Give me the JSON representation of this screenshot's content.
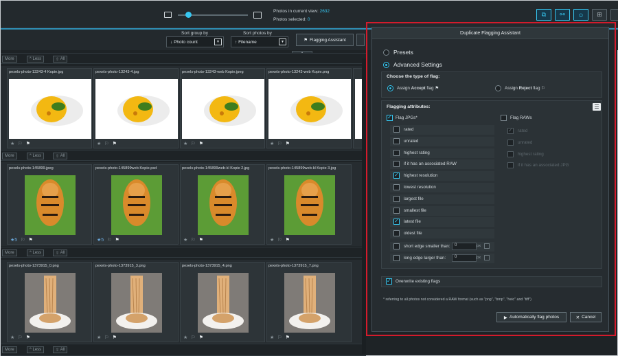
{
  "toolbar": {
    "photos_in_view_label": "Photos in current view:",
    "photos_in_view_value": "2632",
    "photos_selected_label": "Photos selected:",
    "photos_selected_value": "0",
    "zoom_level": 0.15
  },
  "sort": {
    "group_label": "Sort group by",
    "group_value": "Photo count",
    "photos_label": "Sort photos by",
    "photos_value": "Filename",
    "flagging_assistant_label": "Flagging Assistant"
  },
  "group_controls": {
    "more": "More",
    "less": "Less",
    "all": "All"
  },
  "groups": [
    {
      "photos": [
        {
          "filename": "pexels-photo-13243-4 Kopie.jpg"
        },
        {
          "filename": "pexels-photo-13243-4.jpg"
        },
        {
          "filename": "pexels-photo-13243-web Kopie.jpeg"
        },
        {
          "filename": "pexels-photo-13243-web Kopie.png"
        }
      ]
    },
    {
      "photos": [
        {
          "filename": "pexels-photo-145899.jpeg",
          "stars": "5"
        },
        {
          "filename": "pexels-photo-145899web Kopie.psd",
          "stars": "5"
        },
        {
          "filename": "pexels-photo-145899web-kl Kopie 2.jpg"
        },
        {
          "filename": "pexels-photo-145899web-kl Kopie 3.jpg"
        }
      ]
    },
    {
      "photos": [
        {
          "filename": "pexels-photo-1373915_0.png"
        },
        {
          "filename": "pexels-photo-1373915_3.png"
        },
        {
          "filename": "pexels-photo-1373915_4.png"
        },
        {
          "filename": "pexels-photo-1373915_7.png"
        }
      ]
    }
  ],
  "dialog": {
    "title": "Duplicate Flagging Assistant",
    "presets_label": "Presets",
    "advanced_label": "Advanced Settings",
    "flag_type_heading": "Choose the type of flag:",
    "accept_prefix": "Assign",
    "accept_bold": "Accept",
    "accept_suffix": "flag",
    "reject_prefix": "Assign",
    "reject_bold": "Reject",
    "reject_suffix": "flag",
    "attributes_heading": "Flagging attributes:",
    "flag_jpgs_label": "Flag JPGs*",
    "flag_raws_label": "Flag RAWs",
    "jpg_attrs": [
      {
        "label": "rated",
        "checked": false
      },
      {
        "label": "unrated",
        "checked": false
      },
      {
        "label": "highest rating",
        "checked": false
      },
      {
        "label": "if it has an associated RAW",
        "checked": false
      },
      {
        "label": "highest resolution",
        "checked": true
      },
      {
        "label": "lowest resolution",
        "checked": false
      },
      {
        "label": "largest file",
        "checked": false
      },
      {
        "label": "smallest file",
        "checked": false
      },
      {
        "label": "latest file",
        "checked": true
      },
      {
        "label": "oldest file",
        "checked": false
      }
    ],
    "short_edge_label": "short edge smaller than:",
    "short_edge_value": "0",
    "long_edge_label": "long edge larger than:",
    "long_edge_value": "0",
    "px_unit": "px",
    "raw_attrs": [
      {
        "label": "rated",
        "checked": true
      },
      {
        "label": "unrated",
        "checked": false
      },
      {
        "label": "highest rating",
        "checked": false
      },
      {
        "label": "if it has an associated JPG",
        "checked": false
      }
    ],
    "overwrite_label": "Overwrite existing flags",
    "footnote": "* referring to all photos not considered a RAW format (such as \"png\", \"bmp\", \"heic\" and \"tiff\")",
    "auto_button": "Automatically flag photos",
    "cancel_button": "Cancel"
  }
}
